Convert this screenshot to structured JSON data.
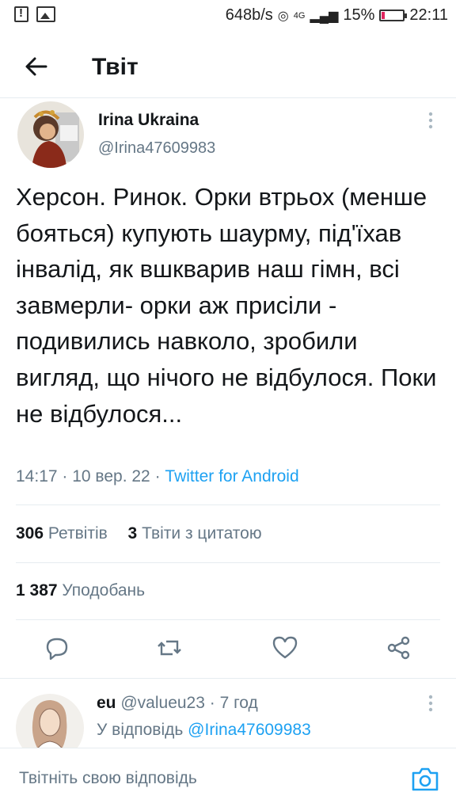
{
  "status_bar": {
    "speed": "648b/s",
    "network": "4G",
    "battery": "15%",
    "time": "22:11"
  },
  "header": {
    "title": "Твіт"
  },
  "tweet": {
    "author_name": "Irina Ukraina",
    "author_handle": "@Irina47609983",
    "text": "Херсон. Ринок. Орки втрьох (менше бояться) купують шаурму, під'їхав інвалід, як вшкварив наш гімн, всі завмерли-  орки аж присіли - подивились навколо, зробили вигляд, що нічого не відбулося. Поки не відбулося...",
    "time": "14:17",
    "date": "10 вер. 22",
    "source": "Twitter for Android"
  },
  "stats": {
    "retweets_count": "306",
    "retweets_label": "Ретвітів",
    "quotes_count": "3",
    "quotes_label": "Твіти з цитатою",
    "likes_count": "1 387",
    "likes_label": "Уподобань"
  },
  "reply": {
    "author_name": "eu",
    "author_handle": "@valueu23",
    "age": "7 год",
    "reply_prefix": "У відповідь",
    "reply_to": "@Irina47609983"
  },
  "compose": {
    "placeholder": "Твітніть свою відповідь"
  },
  "colors": {
    "accent": "#1da1f2",
    "secondary_text": "#657786",
    "divider": "#e6ecf0"
  }
}
